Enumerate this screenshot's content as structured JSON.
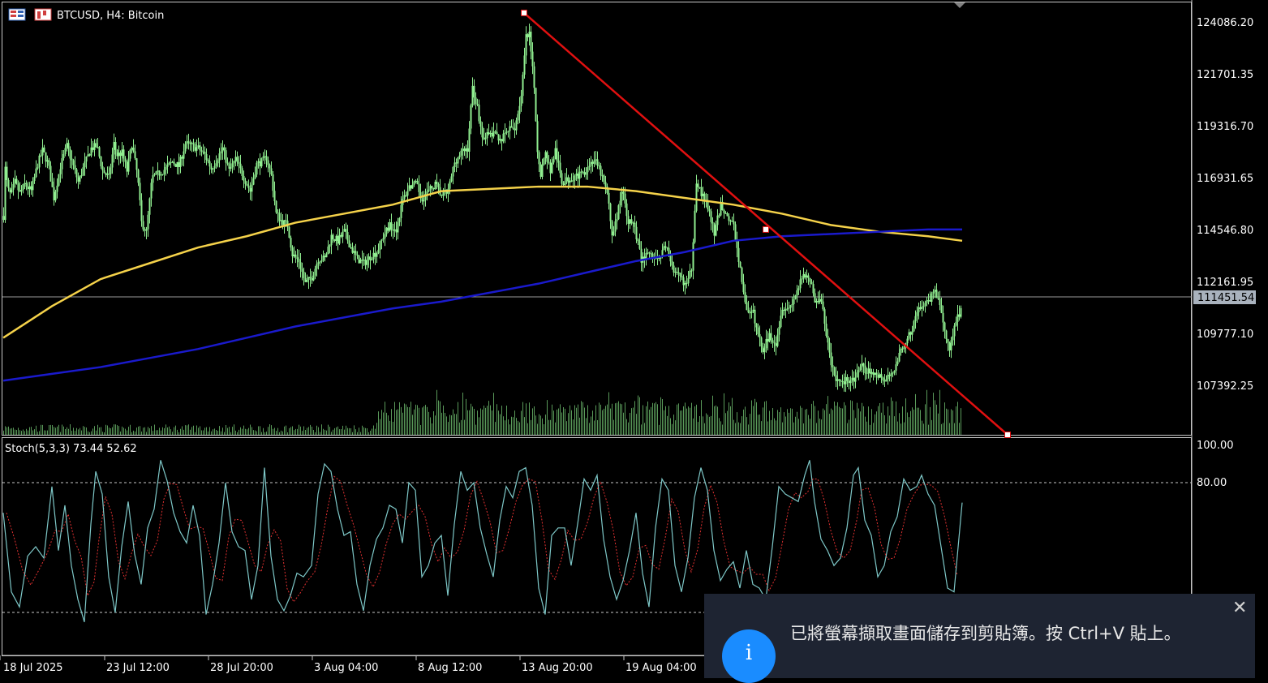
{
  "header": {
    "symbol_label": "BTCUSD, H4:  Bitcoin"
  },
  "price_axis": {
    "ticks": [
      "124086.20",
      "121701.35",
      "119316.70",
      "116931.65",
      "114546.80",
      "112161.95",
      "109777.10",
      "107392.25"
    ],
    "current_price": "111451.54"
  },
  "indicator": {
    "label": "Stoch(5,3,3) 73.44 52.62",
    "k_value": 73.44,
    "d_value": 52.62,
    "ticks": [
      "100.00",
      "80.00"
    ]
  },
  "time_axis": {
    "labels": [
      "18 Jul 2025",
      "23 Jul 12:00",
      "28 Jul 20:00",
      "3 Aug 04:00",
      "8 Aug 12:00",
      "13 Aug 20:00",
      "19 Aug 04:00"
    ]
  },
  "colors": {
    "background": "#000000",
    "grid": "#c8c8c8",
    "candles": "#90ee90",
    "ma_yellow": "#f5d24a",
    "ma_blue": "#1a1acc",
    "trendline": "#e01010",
    "stoch_main": "#7ec8c8",
    "stoch_signal": "#e03030",
    "toast_bg": "#1e2432",
    "toast_icon": "#1a8cff"
  },
  "toast": {
    "message": "已將螢幕擷取畫面儲存到剪貼簿。按 Ctrl+V 貼上。",
    "close_icon": "close-icon",
    "info_icon": "info-icon",
    "info_glyph": "i"
  },
  "chart_data": {
    "type": "candlestick",
    "symbol": "BTCUSD",
    "timeframe": "H4",
    "y_range": [
      105900,
      125100
    ],
    "close_series": [
      [
        0,
        115600
      ],
      [
        2,
        117700
      ],
      [
        5,
        116800
      ],
      [
        9,
        116500
      ],
      [
        14,
        117100
      ],
      [
        20,
        116600
      ],
      [
        26,
        117000
      ],
      [
        34,
        116700
      ],
      [
        42,
        117900
      ],
      [
        48,
        118500
      ],
      [
        55,
        117900
      ],
      [
        62,
        116400
      ],
      [
        70,
        117800
      ],
      [
        78,
        118700
      ],
      [
        86,
        117800
      ],
      [
        92,
        117100
      ],
      [
        100,
        117900
      ],
      [
        108,
        118600
      ],
      [
        115,
        118700
      ],
      [
        122,
        117600
      ],
      [
        130,
        117300
      ],
      [
        136,
        118800
      ],
      [
        140,
        118300
      ],
      [
        146,
        118400
      ],
      [
        152,
        117600
      ],
      [
        158,
        118800
      ],
      [
        165,
        117400
      ],
      [
        170,
        115300
      ],
      [
        176,
        114900
      ],
      [
        183,
        117300
      ],
      [
        192,
        117500
      ],
      [
        200,
        117700
      ],
      [
        208,
        118000
      ],
      [
        216,
        117800
      ],
      [
        224,
        118800
      ],
      [
        232,
        118700
      ],
      [
        240,
        118600
      ],
      [
        248,
        118300
      ],
      [
        256,
        117700
      ],
      [
        264,
        118200
      ],
      [
        270,
        118600
      ],
      [
        278,
        117600
      ],
      [
        286,
        118100
      ],
      [
        295,
        117400
      ],
      [
        304,
        116700
      ],
      [
        312,
        117900
      ],
      [
        318,
        118000
      ],
      [
        324,
        118200
      ],
      [
        330,
        117400
      ],
      [
        336,
        115700
      ],
      [
        342,
        115400
      ],
      [
        350,
        115200
      ],
      [
        356,
        113900
      ],
      [
        364,
        113600
      ],
      [
        372,
        112600
      ],
      [
        380,
        112900
      ],
      [
        388,
        113700
      ],
      [
        396,
        113700
      ],
      [
        404,
        114700
      ],
      [
        412,
        114500
      ],
      [
        420,
        114900
      ],
      [
        428,
        114200
      ],
      [
        436,
        113700
      ],
      [
        444,
        113500
      ],
      [
        452,
        113800
      ],
      [
        460,
        114000
      ],
      [
        468,
        114700
      ],
      [
        476,
        115200
      ],
      [
        484,
        115000
      ],
      [
        492,
        116300
      ],
      [
        500,
        116900
      ],
      [
        508,
        117000
      ],
      [
        516,
        116400
      ],
      [
        524,
        116700
      ],
      [
        532,
        117000
      ],
      [
        540,
        116500
      ],
      [
        548,
        116700
      ],
      [
        556,
        118000
      ],
      [
        564,
        118400
      ],
      [
        572,
        118600
      ],
      [
        578,
        121300
      ],
      [
        584,
        120400
      ],
      [
        590,
        119100
      ],
      [
        598,
        119200
      ],
      [
        606,
        119200
      ],
      [
        614,
        119000
      ],
      [
        622,
        119400
      ],
      [
        630,
        119500
      ],
      [
        638,
        120900
      ],
      [
        644,
        123500
      ],
      [
        648,
        123600
      ],
      [
        654,
        121300
      ],
      [
        658,
        118500
      ],
      [
        662,
        117500
      ],
      [
        668,
        118400
      ],
      [
        674,
        117600
      ],
      [
        680,
        118500
      ],
      [
        688,
        117100
      ],
      [
        696,
        117200
      ],
      [
        704,
        117400
      ],
      [
        712,
        117400
      ],
      [
        720,
        117800
      ],
      [
        728,
        118100
      ],
      [
        736,
        117500
      ],
      [
        744,
        116600
      ],
      [
        750,
        114800
      ],
      [
        756,
        115500
      ],
      [
        762,
        116800
      ],
      [
        770,
        115400
      ],
      [
        778,
        115100
      ],
      [
        786,
        113600
      ],
      [
        794,
        114000
      ],
      [
        802,
        113700
      ],
      [
        810,
        113900
      ],
      [
        818,
        114300
      ],
      [
        826,
        113000
      ],
      [
        834,
        112900
      ],
      [
        842,
        112500
      ],
      [
        848,
        113300
      ],
      [
        854,
        117200
      ],
      [
        860,
        116600
      ],
      [
        868,
        116000
      ],
      [
        876,
        114800
      ],
      [
        884,
        116100
      ],
      [
        892,
        115600
      ],
      [
        900,
        115100
      ],
      [
        906,
        113700
      ],
      [
        912,
        112200
      ],
      [
        918,
        111200
      ],
      [
        924,
        111300
      ],
      [
        930,
        110300
      ],
      [
        936,
        109700
      ],
      [
        944,
        110300
      ],
      [
        952,
        110000
      ],
      [
        960,
        111600
      ],
      [
        968,
        111500
      ],
      [
        976,
        112100
      ],
      [
        984,
        112800
      ],
      [
        992,
        113000
      ],
      [
        1000,
        111900
      ],
      [
        1008,
        111800
      ],
      [
        1014,
        110400
      ],
      [
        1020,
        109000
      ],
      [
        1026,
        108300
      ],
      [
        1034,
        108300
      ],
      [
        1042,
        108300
      ],
      [
        1050,
        108400
      ],
      [
        1058,
        108900
      ],
      [
        1066,
        108700
      ],
      [
        1074,
        108600
      ],
      [
        1080,
        108500
      ],
      [
        1086,
        108300
      ],
      [
        1094,
        108500
      ],
      [
        1102,
        109300
      ],
      [
        1110,
        109900
      ],
      [
        1118,
        110400
      ],
      [
        1126,
        111400
      ],
      [
        1134,
        111600
      ],
      [
        1142,
        111800
      ],
      [
        1148,
        112400
      ],
      [
        1154,
        111500
      ],
      [
        1160,
        110400
      ],
      [
        1166,
        109800
      ],
      [
        1172,
        110600
      ],
      [
        1176,
        111200
      ],
      [
        1180,
        111400
      ]
    ],
    "moving_average_yellow": [
      [
        0,
        110200
      ],
      [
        60,
        111600
      ],
      [
        120,
        112800
      ],
      [
        180,
        113500
      ],
      [
        240,
        114200
      ],
      [
        300,
        114700
      ],
      [
        360,
        115300
      ],
      [
        420,
        115700
      ],
      [
        480,
        116100
      ],
      [
        540,
        116700
      ],
      [
        600,
        116800
      ],
      [
        660,
        116900
      ],
      [
        720,
        116900
      ],
      [
        780,
        116700
      ],
      [
        840,
        116400
      ],
      [
        900,
        116100
      ],
      [
        960,
        115700
      ],
      [
        1020,
        115200
      ],
      [
        1080,
        114900
      ],
      [
        1140,
        114700
      ],
      [
        1182,
        114500
      ]
    ],
    "moving_average_blue": [
      [
        0,
        108300
      ],
      [
        60,
        108600
      ],
      [
        120,
        108900
      ],
      [
        180,
        109300
      ],
      [
        240,
        109700
      ],
      [
        300,
        110200
      ],
      [
        360,
        110700
      ],
      [
        420,
        111100
      ],
      [
        480,
        111500
      ],
      [
        540,
        111800
      ],
      [
        600,
        112200
      ],
      [
        660,
        112600
      ],
      [
        720,
        113100
      ],
      [
        780,
        113600
      ],
      [
        840,
        114000
      ],
      [
        900,
        114500
      ],
      [
        960,
        114700
      ],
      [
        1020,
        114800
      ],
      [
        1080,
        114900
      ],
      [
        1140,
        115000
      ],
      [
        1182,
        115000
      ]
    ],
    "trendline": {
      "start": [
        642,
        124600
      ],
      "middle": [
        940,
        115000
      ],
      "end": [
        1238,
        105900
      ]
    },
    "stochastic": {
      "levels": [
        100,
        80,
        20
      ],
      "k_series": [
        [
          0,
          68
        ],
        [
          10,
          26
        ],
        [
          20,
          18
        ],
        [
          30,
          45
        ],
        [
          40,
          50
        ],
        [
          50,
          44
        ],
        [
          60,
          82
        ],
        [
          68,
          48
        ],
        [
          76,
          72
        ],
        [
          84,
          40
        ],
        [
          92,
          22
        ],
        [
          100,
          10
        ],
        [
          108,
          62
        ],
        [
          114,
          90
        ],
        [
          122,
          78
        ],
        [
          130,
          34
        ],
        [
          138,
          15
        ],
        [
          146,
          50
        ],
        [
          154,
          74
        ],
        [
          162,
          46
        ],
        [
          170,
          30
        ],
        [
          178,
          60
        ],
        [
          186,
          70
        ],
        [
          194,
          96
        ],
        [
          202,
          85
        ],
        [
          210,
          68
        ],
        [
          218,
          58
        ],
        [
          226,
          52
        ],
        [
          234,
          72
        ],
        [
          242,
          56
        ],
        [
          250,
          14
        ],
        [
          258,
          30
        ],
        [
          266,
          52
        ],
        [
          274,
          84
        ],
        [
          282,
          58
        ],
        [
          290,
          50
        ],
        [
          298,
          48
        ],
        [
          306,
          22
        ],
        [
          314,
          40
        ],
        [
          322,
          92
        ],
        [
          330,
          45
        ],
        [
          338,
          22
        ],
        [
          346,
          16
        ],
        [
          354,
          24
        ],
        [
          362,
          36
        ],
        [
          370,
          34
        ],
        [
          380,
          40
        ],
        [
          388,
          78
        ],
        [
          396,
          94
        ],
        [
          404,
          90
        ],
        [
          412,
          70
        ],
        [
          420,
          56
        ],
        [
          428,
          58
        ],
        [
          436,
          30
        ],
        [
          444,
          16
        ],
        [
          452,
          40
        ],
        [
          460,
          54
        ],
        [
          468,
          60
        ],
        [
          476,
          72
        ],
        [
          484,
          70
        ],
        [
          492,
          52
        ],
        [
          500,
          84
        ],
        [
          508,
          80
        ],
        [
          516,
          34
        ],
        [
          524,
          40
        ],
        [
          532,
          52
        ],
        [
          540,
          56
        ],
        [
          548,
          24
        ],
        [
          556,
          62
        ],
        [
          564,
          90
        ],
        [
          572,
          80
        ],
        [
          580,
          84
        ],
        [
          588,
          60
        ],
        [
          596,
          46
        ],
        [
          604,
          34
        ],
        [
          612,
          64
        ],
        [
          620,
          82
        ],
        [
          628,
          76
        ],
        [
          636,
          90
        ],
        [
          644,
          92
        ],
        [
          652,
          72
        ],
        [
          660,
          28
        ],
        [
          668,
          14
        ],
        [
          676,
          56
        ],
        [
          684,
          60
        ],
        [
          692,
          60
        ],
        [
          700,
          40
        ],
        [
          708,
          62
        ],
        [
          716,
          86
        ],
        [
          724,
          80
        ],
        [
          732,
          88
        ],
        [
          740,
          54
        ],
        [
          748,
          34
        ],
        [
          756,
          22
        ],
        [
          764,
          32
        ],
        [
          772,
          48
        ],
        [
          780,
          68
        ],
        [
          788,
          36
        ],
        [
          796,
          18
        ],
        [
          804,
          60
        ],
        [
          812,
          86
        ],
        [
          820,
          80
        ],
        [
          828,
          40
        ],
        [
          836,
          26
        ],
        [
          844,
          44
        ],
        [
          852,
          76
        ],
        [
          860,
          92
        ],
        [
          868,
          80
        ],
        [
          876,
          48
        ],
        [
          884,
          32
        ],
        [
          892,
          38
        ],
        [
          900,
          42
        ],
        [
          908,
          28
        ],
        [
          916,
          48
        ],
        [
          924,
          30
        ],
        [
          932,
          28
        ],
        [
          940,
          22
        ],
        [
          948,
          50
        ],
        [
          956,
          82
        ],
        [
          964,
          78
        ],
        [
          972,
          76
        ],
        [
          980,
          74
        ],
        [
          988,
          88
        ],
        [
          994,
          96
        ],
        [
          1000,
          74
        ],
        [
          1008,
          54
        ],
        [
          1016,
          48
        ],
        [
          1024,
          40
        ],
        [
          1032,
          44
        ],
        [
          1040,
          60
        ],
        [
          1048,
          88
        ],
        [
          1054,
          92
        ],
        [
          1062,
          64
        ],
        [
          1070,
          56
        ],
        [
          1078,
          34
        ],
        [
          1086,
          40
        ],
        [
          1094,
          58
        ],
        [
          1102,
          66
        ],
        [
          1110,
          86
        ],
        [
          1118,
          80
        ],
        [
          1126,
          82
        ],
        [
          1132,
          88
        ],
        [
          1140,
          78
        ],
        [
          1148,
          72
        ],
        [
          1156,
          50
        ],
        [
          1164,
          28
        ],
        [
          1172,
          26
        ],
        [
          1182,
          73.44
        ]
      ]
    }
  }
}
